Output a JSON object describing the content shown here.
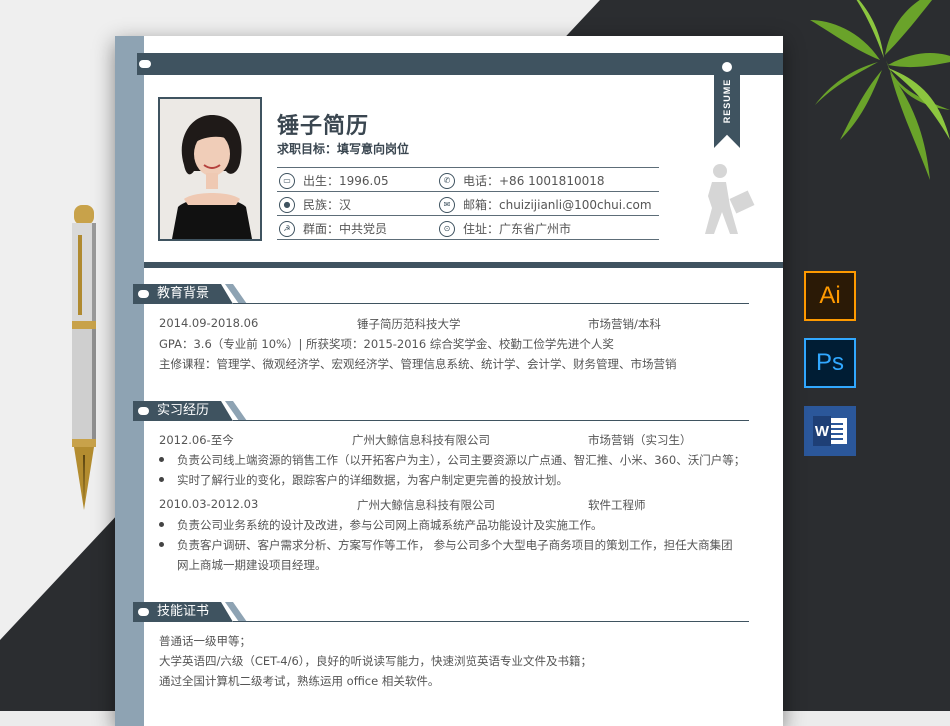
{
  "resume": {
    "ribbon": "RESUME",
    "name": "锤子简历",
    "objective": "求职目标：填写意向岗位",
    "info": {
      "birth": "出生：1996.05",
      "phone": "电话：+86 1001810018",
      "ethnicity": "民族：汉",
      "email": "邮箱：chuizijianli@100chui.com",
      "party": "群面：中共党员",
      "address": "住址：广东省广州市"
    }
  },
  "education": {
    "title": "教育背景",
    "period": "2014.09-2018.06",
    "school": "锤子简历范科技大学",
    "major": "市场营销/本科",
    "gpa": "GPA：3.6（专业前 10%）| 所获奖项：2015-2016 综合奖学金、校勤工俭学先进个人奖",
    "courses": "主修课程：管理学、微观经济学、宏观经济学、管理信息系统、统计学、会计学、财务管理、市场营销"
  },
  "internship": {
    "title": "实习经历",
    "jobs": [
      {
        "period": "2012.06-至今",
        "company": "广州大鲸信息科技有限公司",
        "role": "市场营销（实习生）",
        "bullets": [
          "负责公司线上端资源的销售工作（以开拓客户为主），公司主要资源以广点通、智汇推、小米、360、沃门户等；",
          "实时了解行业的变化，跟踪客户的详细数据，为客户制定更完善的投放计划。"
        ]
      },
      {
        "period": "2010.03-2012.03",
        "company": "广州大鲸信息科技有限公司",
        "role": "软件工程师",
        "bullets": [
          "负责公司业务系统的设计及改进，参与公司网上商城系统产品功能设计及实施工作。",
          "负责客户调研、客户需求分析、方案写作等工作， 参与公司多个大型电子商务项目的策划工作，担任大商集团",
          "网上商城一期建设项目经理。"
        ]
      }
    ]
  },
  "skills": {
    "title": "技能证书",
    "lines": [
      "普通话一级甲等；",
      "大学英语四/六级（CET-4/6），良好的听说读写能力，快速浏览英语专业文件及书籍；",
      "通过全国计算机二级考试，熟练运用 office 相关软件。"
    ]
  },
  "app_icons": [
    {
      "label": "Ai",
      "bg": "#2b1a06",
      "fg": "#ff9a00",
      "border": "#ff9a00"
    },
    {
      "label": "Ps",
      "bg": "#001d34",
      "fg": "#31a8ff",
      "border": "#31a8ff"
    },
    {
      "label": "W",
      "bg": "#2b579a",
      "fg": "#ffffff",
      "border": "#ffffff"
    }
  ],
  "colors": {
    "accent_dark": "#3f5360",
    "accent_light": "#8ea3b3",
    "text": "#555555"
  }
}
